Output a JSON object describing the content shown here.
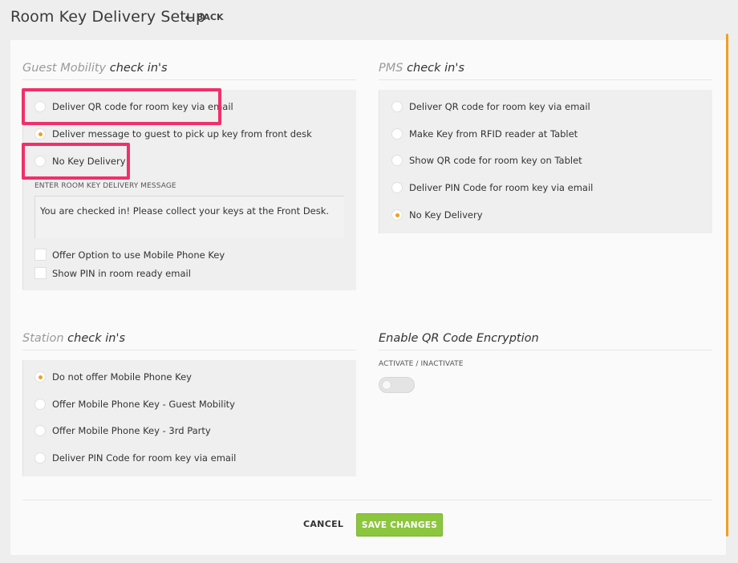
{
  "header": {
    "title": "Room Key Delivery Setup",
    "back_label": "BACK"
  },
  "guest_mobility": {
    "title_light": "Guest Mobility",
    "title_dark": "check in's",
    "options": [
      {
        "label": "Deliver QR code for room key via email",
        "checked": false
      },
      {
        "label": "Deliver message to guest to pick up key from front desk",
        "checked": true
      },
      {
        "label": "No Key Delivery",
        "checked": false
      }
    ],
    "message_label": "ENTER ROOM KEY DELIVERY MESSAGE",
    "message_value": "You are checked in! Please collect your keys at the Front Desk.",
    "checkboxes": [
      {
        "label": "Offer Option to use Mobile Phone Key",
        "checked": false
      },
      {
        "label": "Show PIN in room ready email",
        "checked": false
      }
    ]
  },
  "pms": {
    "title_light": "PMS",
    "title_dark": "check in's",
    "options": [
      {
        "label": "Deliver QR code for room key via email",
        "checked": false
      },
      {
        "label": "Make Key from RFID reader at Tablet",
        "checked": false
      },
      {
        "label": "Show QR code for room key on Tablet",
        "checked": false
      },
      {
        "label": "Deliver PIN Code for room key via email",
        "checked": false
      },
      {
        "label": "No Key Delivery",
        "checked": true
      }
    ]
  },
  "station": {
    "title_light": "Station",
    "title_dark": "check in's",
    "options": [
      {
        "label": "Do not offer Mobile Phone Key",
        "checked": true
      },
      {
        "label": "Offer Mobile Phone Key - Guest Mobility",
        "checked": false
      },
      {
        "label": "Offer Mobile Phone Key - 3rd Party",
        "checked": false
      },
      {
        "label": "Deliver PIN Code for room key via email",
        "checked": false
      }
    ]
  },
  "qr_encryption": {
    "title": "Enable QR Code Encryption",
    "toggle_label": "ACTIVATE / INACTIVATE",
    "enabled": false
  },
  "footer": {
    "cancel_label": "CANCEL",
    "save_label": "SAVE CHANGES"
  },
  "colors": {
    "accent": "#f0a020",
    "highlight": "#f0306a",
    "save": "#8cc63f"
  }
}
